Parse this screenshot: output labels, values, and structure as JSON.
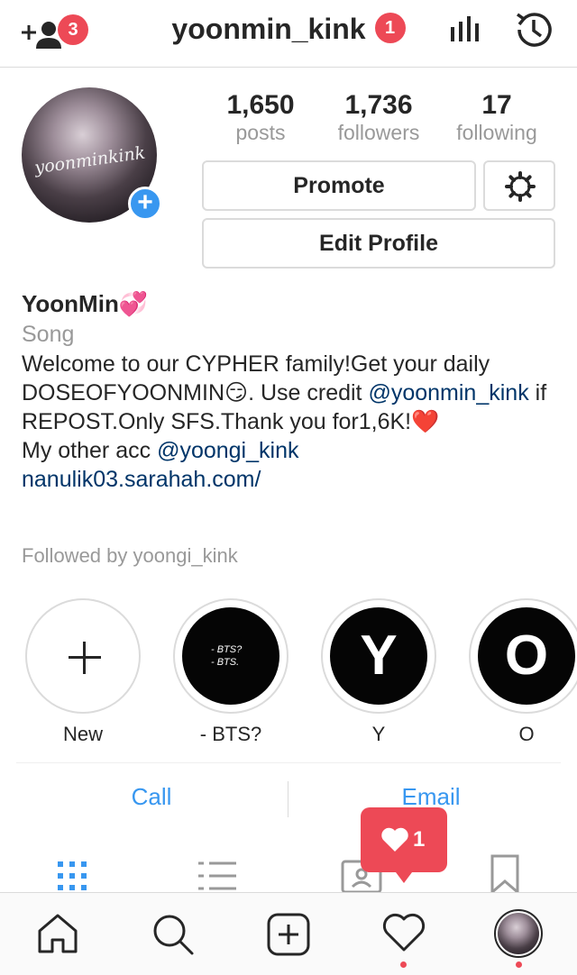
{
  "header": {
    "username": "yoonmin_kink",
    "account_badge": "1",
    "follow_requests_badge": "3"
  },
  "profile": {
    "avatar_text": "yoonminkink",
    "stats": [
      {
        "value": "1,650",
        "label": "posts"
      },
      {
        "value": "1,736",
        "label": "followers"
      },
      {
        "value": "17",
        "label": "following"
      }
    ],
    "promote_label": "Promote",
    "edit_label": "Edit Profile"
  },
  "bio": {
    "name": "YoonMin💞",
    "category": "Song",
    "line1": "Welcome to our CYPHER family!Get your daily DOSEOFYOONMIN😏. Use credit ",
    "mention1": "@yoonmin_kink",
    "line2": " if REPOST.Only SFS.Thank you for1,6K!❤️",
    "other_prefix": "My other acc ",
    "mention2": "@yoongi_kink",
    "website": "nanulik03.sarahah.com/",
    "followed_by": "Followed by yoongi_kink"
  },
  "highlights": [
    {
      "label": "New"
    },
    {
      "label": "- BTS?",
      "cover_line1": "- BTS?",
      "cover_line2": "- BTS."
    },
    {
      "label": "Y",
      "cover": "Y"
    },
    {
      "label": "O",
      "cover": "O"
    }
  ],
  "contact": {
    "call_label": "Call",
    "email_label": "Email"
  },
  "activity_popup": {
    "count": "1"
  },
  "colors": {
    "accent": "#3897f0",
    "badge": "#ed4956",
    "link": "#003569",
    "muted": "#999999"
  },
  "icons": {
    "top_left": "add-user-icon",
    "top_right": [
      "insights-icon",
      "archive-clock-icon"
    ],
    "tabs": [
      "grid-icon",
      "list-icon",
      "tagged-icon",
      "saved-icon"
    ],
    "bottom": [
      "home-icon",
      "search-icon",
      "new-post-icon",
      "activity-heart-icon",
      "profile-avatar-icon"
    ]
  }
}
